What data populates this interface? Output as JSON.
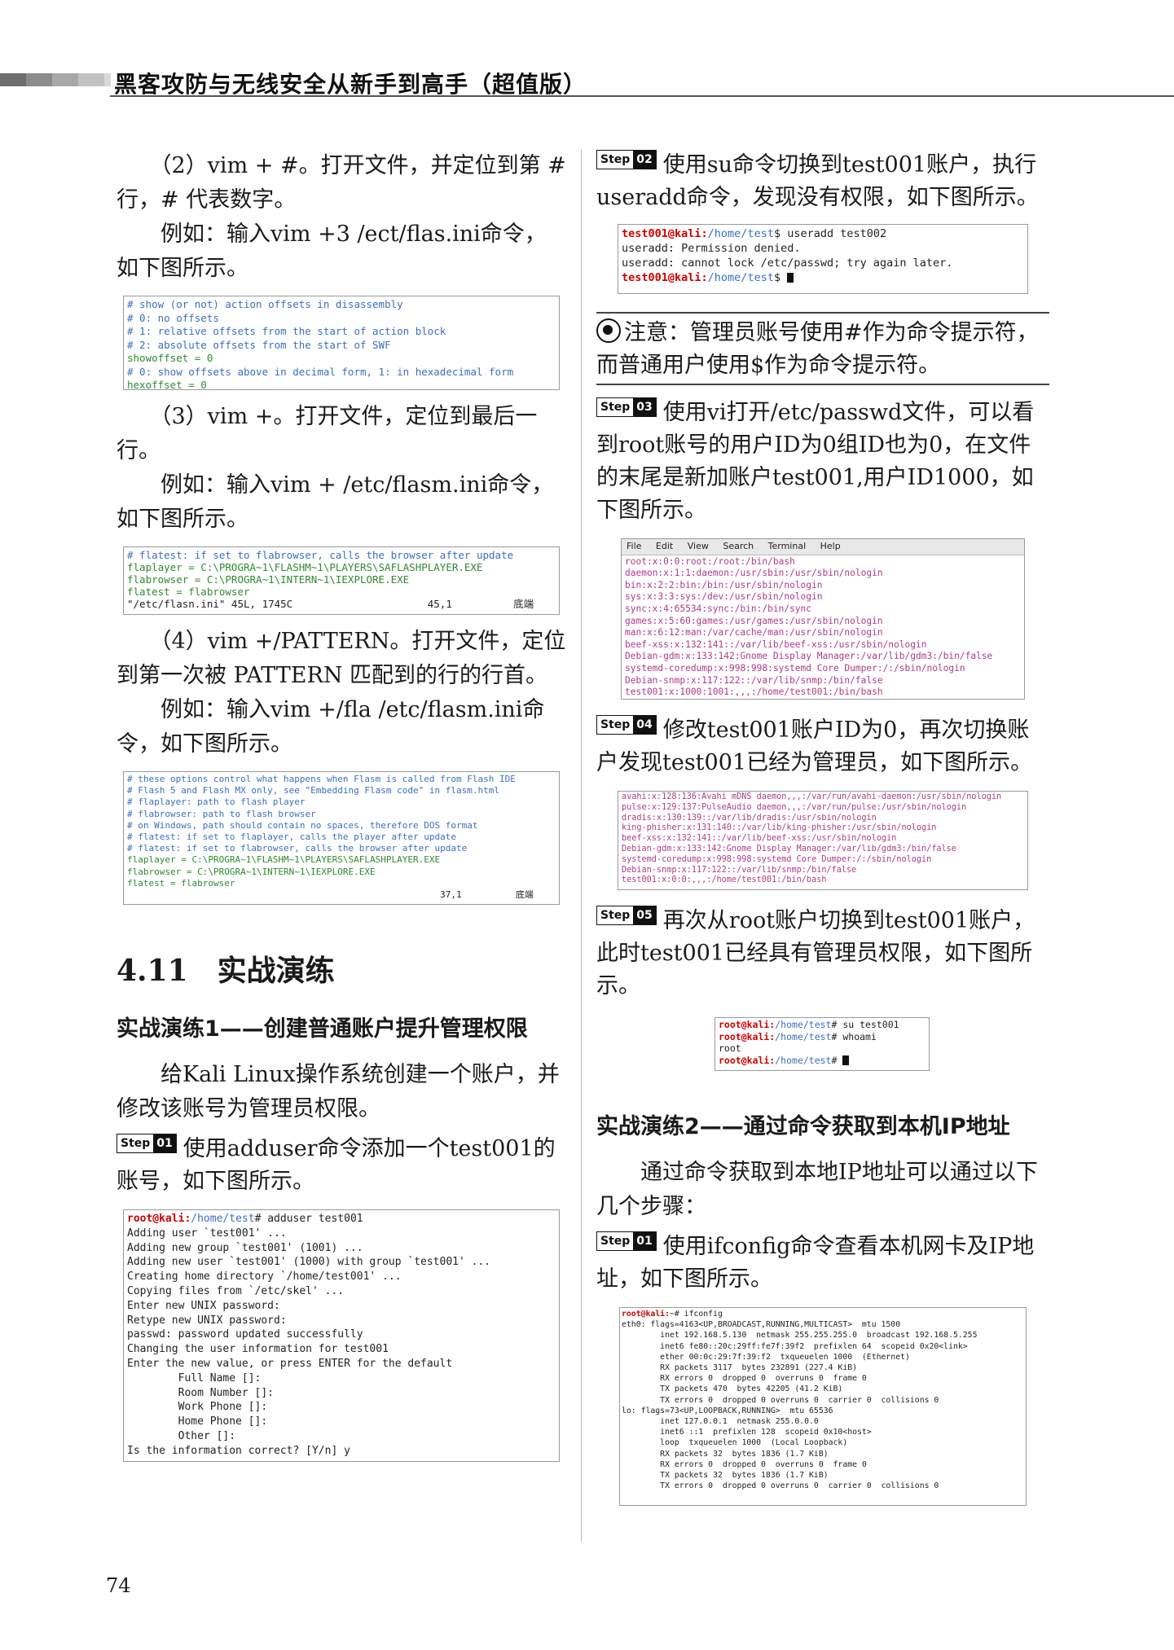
{
  "header": {
    "title": "黑客攻防与无线安全从新手到高手（超值版）",
    "bar_colors": [
      "#6e6e6e",
      "#8c8c8c",
      "#a8a8a8",
      "#c2c2c2",
      "#d9d9d9"
    ]
  },
  "left": {
    "p1a": "（2）vim + #。打开文件，并定位到第 # 行，# 代表数字。",
    "p1b": "例如：输入vim +3 /ect/flas.ini命令，如下图所示。",
    "term1": [
      "# show (or not) action offsets in disassembly",
      "# 0: no offsets",
      "# 1: relative offsets from the start of action block",
      "# 2: absolute offsets from the start of SWF",
      "showoffset = 0",
      "# 0: show offsets above in decimal form, 1: in hexadecimal form",
      "hexoffset = 0"
    ],
    "p2a": "（3）vim +。打开文件，定位到最后一行。",
    "p2b": "例如：输入vim + /etc/flasm.ini命令，如下图所示。",
    "term2": [
      "# flatest: if set to flabrowser, calls the browser after update",
      "flaplayer = C:\\PROGRA~1\\FLASHM~1\\PLAYERS\\SAFLASHPLAYER.EXE",
      "flabrowser = C:\\PROGRA~1\\INTERN~1\\IEXPLORE.EXE",
      "flatest = flabrowser",
      "\"/etc/flasn.ini\" 45L, 1745C                      45,1          底端"
    ],
    "p3a": "（4）vim +/PATTERN。打开文件，定位到第一次被 PATTERN 匹配到的行的行首。",
    "p3b": "例如：输入vim +/fla /etc/flasm.ini命令，如下图所示。",
    "term3": [
      "# these options control what happens when Flasm is called from Flash IDE",
      "# Flash 5 and Flash MX only, see \"Embedding Flasm code\" in flasm.html",
      "# flaplayer: path to flash player",
      "# flabrowser: path to flash browser",
      "# on Windows, path should contain no spaces, therefore DOS format",
      "# flatest: if set to flaplayer, calls the player after update",
      "# flatest: if set to flabrowser, calls the browser after update",
      "flaplayer = C:\\PROGRA~1\\FLASHM~1\\PLAYERS\\SAFLASHPLAYER.EXE",
      "flabrowser = C:\\PROGRA~1\\INTERN~1\\IEXPLORE.EXE",
      "flatest = flabrowser",
      "                                                          37,1          底端"
    ],
    "section": "4.11　实战演练",
    "sub1": "实战演练1——创建普通账户提升管理权限",
    "p4": "给Kali Linux操作系统创建一个账户，并修改该账号为管理员权限。",
    "step_word": "Step",
    "step01_num": "01",
    "step01_text": "使用adduser命令添加一个test001的账号，如下图所示。",
    "term4_prompt": "root@kali:",
    "term4_path": "/home/test",
    "term4_cmd": "# adduser test001",
    "term4": [
      "Adding user `test001' ...",
      "Adding new group `test001' (1001) ...",
      "Adding new user `test001' (1000) with group `test001' ...",
      "Creating home directory `/home/test001' ...",
      "Copying files from `/etc/skel' ...",
      "Enter new UNIX password:",
      "Retype new UNIX password:",
      "passwd: password updated successfully",
      "Changing the user information for test001",
      "Enter the new value, or press ENTER for the default",
      "        Full Name []:",
      "        Room Number []:",
      "        Work Phone []:",
      "        Home Phone []:",
      "        Other []:",
      "Is the information correct? [Y/n] y"
    ]
  },
  "right": {
    "step02_num": "02",
    "step02_text": "使用su命令切换到test001账户，执行useradd命令，发现没有权限，如下图所示。",
    "t5_prompt": "test001@kali:",
    "t5_path": "/home/test",
    "t5_cmd": "$ useradd test002",
    "t5_l2": "useradd: Permission denied.",
    "t5_l3": "useradd: cannot lock /etc/passwd; try again later.",
    "t5_end": "$ ",
    "note_text": "注意：管理员账号使用#作为命令提示符，而普通用户使用$作为命令提示符。",
    "step03_num": "03",
    "step03_text": "使用vi打开/etc/passwd文件，可以看到root账号的用户ID为0组ID也为0，在文件的末尾是新加账户test001,用户ID1000，如下图所示。",
    "menu": [
      "File",
      "Edit",
      "View",
      "Search",
      "Terminal",
      "Help"
    ],
    "t6": [
      "root:x:0:0:root:/root:/bin/bash",
      "daemon:x:1:1:daemon:/usr/sbin:/usr/sbin/nologin",
      "bin:x:2:2:bin:/bin:/usr/sbin/nologin",
      "sys:x:3:3:sys:/dev:/usr/sbin/nologin",
      "sync:x:4:65534:sync:/bin:/bin/sync",
      "games:x:5:60:games:/usr/games:/usr/sbin/nologin",
      "man:x:6:12:man:/var/cache/man:/usr/sbin/nologin",
      "beef-xss:x:132:141::/var/lib/beef-xss:/usr/sbin/nologin",
      "Debian-gdm:x:133:142:Gnome Display Manager:/var/lib/gdm3:/bin/false",
      "systemd-coredump:x:998:998:systemd Core Dumper:/:/sbin/nologin",
      "Debian-snmp:x:117:122::/var/lib/snmp:/bin/false",
      "test001:x:1000:1001:,,,:/home/test001:/bin/bash"
    ],
    "step04_num": "04",
    "step04_text": "修改test001账户ID为0，再次切换账户发现test001已经为管理员，如下图所示。",
    "t7": [
      "avahi:x:128:136:Avahi mDNS daemon,,,:/var/run/avahi-daemon:/usr/sbin/nologin",
      "pulse:x:129:137:PulseAudio daemon,,,:/var/run/pulse:/usr/sbin/nologin",
      "dradis:x:130:139::/var/lib/dradis:/usr/sbin/nologin",
      "king-phisher:x:131:140::/var/lib/king-phisher:/usr/sbin/nologin",
      "beef-xss:x:132:141::/var/lib/beef-xss:/usr/sbin/nologin",
      "Debian-gdm:x:133:142:Gnome Display Manager:/var/lib/gdm3:/bin/false",
      "systemd-coredump:x:998:998:systemd Core Dumper:/:/sbin/nologin",
      "Debian-snmp:x:117:122::/var/lib/snmp:/bin/false",
      "test001:x:0:0:,,,:/home/test001:/bin/bash"
    ],
    "step05_num": "05",
    "step05_text": "再次从root账户切换到test001账户，此时test001已经具有管理员权限，如下图所示。",
    "t8_prompt": "root@kali:",
    "t8_path": "/home/test",
    "t8_l1": "# su test001",
    "t8_l2": "# whoami",
    "t8_l3": "root",
    "t8_l4": "# ",
    "sub2": "实战演练2——通过命令获取到本机IP地址",
    "p5": "通过命令获取到本地IP地址可以通过以下几个步骤：",
    "step01b_num": "01",
    "step01b_text": "使用ifconfig命令查看本机网卡及IP地址，如下图所示。",
    "t9_prompt": "root@kali:",
    "t9_cmd": "~# ifconfig",
    "t9": [
      "eth0: flags=4163<UP,BROADCAST,RUNNING,MULTICAST>  mtu 1500",
      "        inet 192.168.5.130  netmask 255.255.255.0  broadcast 192.168.5.255",
      "        inet6 fe80::20c:29ff:fe7f:39f2  prefixlen 64  scopeid 0x20<link>",
      "        ether 00:0c:29:7f:39:f2  txqueuelen 1000  (Ethernet)",
      "        RX packets 3117  bytes 232891 (227.4 KiB)",
      "        RX errors 0  dropped 0  overruns 0  frame 0",
      "        TX packets 470  bytes 42205 (41.2 KiB)",
      "        TX errors 0  dropped 0 overruns 0  carrier 0  collisions 0",
      "",
      "lo: flags=73<UP,LOOPBACK,RUNNING>  mtu 65536",
      "        inet 127.0.0.1  netmask 255.0.0.0",
      "        inet6 ::1  prefixlen 128  scopeid 0x10<host>",
      "        loop  txqueuelen 1000  (Local Loopback)",
      "        RX packets 32  bytes 1836 (1.7 KiB)",
      "        RX errors 0  dropped 0  overruns 0  frame 0",
      "        TX packets 32  bytes 1836 (1.7 KiB)",
      "        TX errors 0  dropped 0 overruns 0  carrier 0  collisions 0"
    ]
  },
  "page_number": "74"
}
